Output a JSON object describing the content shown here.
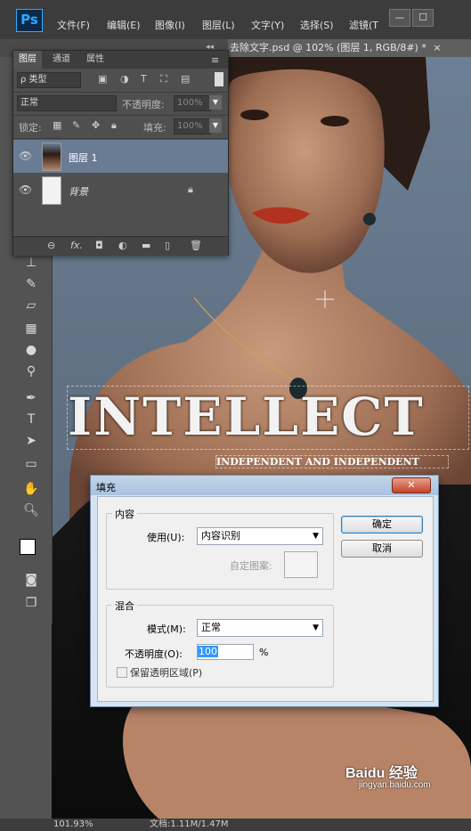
{
  "app": {
    "logo": "Ps"
  },
  "menu": [
    "文件(F)",
    "编辑(E)",
    "图像(I)",
    "图层(L)",
    "文字(Y)",
    "选择(S)",
    "滤镜(T"
  ],
  "window_buttons": [
    "—",
    "☐"
  ],
  "doc_tab": "去除文字.psd @ 102% (图层 1, RGB/8#) *",
  "doc_tab_close": "×",
  "layers_panel": {
    "tabs": [
      "图层",
      "通道",
      "属性"
    ],
    "collapse": "◂◂",
    "filter": {
      "label": "ρ 类型",
      "icons": [
        "image-icon",
        "adjust-icon",
        "text-icon",
        "shape-icon",
        "smart-icon"
      ]
    },
    "blend_mode": "正常",
    "opacity_label": "不透明度:",
    "opacity_value": "100%",
    "lock_label": "锁定:",
    "fill_label": "填充:",
    "fill_value": "100%",
    "layers": [
      {
        "name": "图层 1",
        "selected": true
      },
      {
        "name": "背景",
        "locked": true
      }
    ]
  },
  "artwork": {
    "headline": "INTELLECT",
    "subline": "INDEPENDENT AND INDEPENDENT"
  },
  "status": {
    "zoom": "101.93%",
    "doc": "文档:1.11M/1.47M"
  },
  "dialog": {
    "title": "填充",
    "close": "✕",
    "content_group": "内容",
    "use_label": "使用(U):",
    "use_value": "内容识别",
    "custom_pattern_label": "自定图案:",
    "blend_group": "混合",
    "mode_label": "模式(M):",
    "mode_value": "正常",
    "opacity_label": "不透明度(O):",
    "opacity_value": "100",
    "percent": "%",
    "preserve_label": "保留透明区域(P)",
    "ok": "确定",
    "cancel": "取消"
  },
  "watermark": {
    "brand": "Baidu 经验",
    "url": "jingyan.baidu.com"
  }
}
